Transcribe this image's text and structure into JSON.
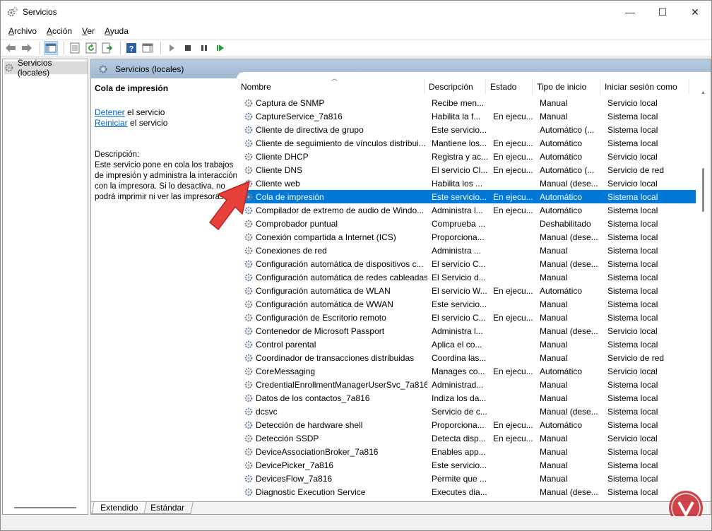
{
  "window": {
    "title": "Servicios",
    "minimize": "—",
    "maximize": "☐",
    "close": "✕"
  },
  "menu": [
    {
      "label": "Archivo",
      "ul": "A",
      "rest": "rchivo"
    },
    {
      "label": "Acción",
      "ul": "A",
      "rest": "cción"
    },
    {
      "label": "Ver",
      "ul": "V",
      "rest": "er"
    },
    {
      "label": "Ayuda",
      "ul": "A",
      "rest": "yuda"
    }
  ],
  "tree": {
    "root_label": "Servicios (locales)"
  },
  "pane": {
    "header_label": "Servicios (locales)",
    "selected_service": "Cola de impresión",
    "stop_link": "Detener",
    "stop_suffix": " el servicio",
    "restart_link": "Reiniciar",
    "restart_suffix": " el servicio",
    "desc_heading": "Descripción:",
    "desc_text": "Este servicio pone en cola los trabajos de impresión y administra la interacción con la impresora. Si lo desactiva, no podrá imprimir ni ver las impresoras."
  },
  "columns": [
    "Nombre",
    "Descripción",
    "Estado",
    "Tipo de inicio",
    "Iniciar sesión como"
  ],
  "rows": [
    [
      "Captura de SNMP",
      "Recibe men...",
      "",
      "Manual",
      "Servicio local"
    ],
    [
      "CaptureService_7a816",
      "Habilita la f...",
      "En ejecu...",
      "Manual",
      "Sistema local"
    ],
    [
      "Cliente de directiva de grupo",
      "Este servicio...",
      "",
      "Automático (...",
      "Sistema local"
    ],
    [
      "Cliente de seguimiento de vínculos distribui...",
      "Mantiene los...",
      "En ejecu...",
      "Automático",
      "Sistema local"
    ],
    [
      "Cliente DHCP",
      "Registra y ac...",
      "En ejecu...",
      "Automático",
      "Servicio local"
    ],
    [
      "Cliente DNS",
      "El servicio Cl...",
      "En ejecu...",
      "Automático (...",
      "Servicio de red"
    ],
    [
      "Cliente web",
      "Habilita los ...",
      "",
      "Manual (dese...",
      "Servicio local"
    ],
    [
      "Cola de impresión",
      "Este servicio...",
      "En ejecu...",
      "Automático",
      "Sistema local"
    ],
    [
      "Compilador de extremo de audio de Windo...",
      "Administra l...",
      "En ejecu...",
      "Automático",
      "Sistema local"
    ],
    [
      "Comprobador puntual",
      "Comprueba ...",
      "",
      "Deshabilitado",
      "Sistema local"
    ],
    [
      "Conexión compartida a Internet (ICS)",
      "Proporciona...",
      "",
      "Manual (dese...",
      "Sistema local"
    ],
    [
      "Conexiones de red",
      "Administra ...",
      "",
      "Manual",
      "Sistema local"
    ],
    [
      "Configuración automática de dispositivos c...",
      "El servicio C...",
      "",
      "Manual (dese...",
      "Sistema local"
    ],
    [
      "Configuración automática de redes cableadas",
      "El Servicio d...",
      "",
      "Manual",
      "Sistema local"
    ],
    [
      "Configuración automática de WLAN",
      "El servicio W...",
      "En ejecu...",
      "Automático",
      "Sistema local"
    ],
    [
      "Configuración automática de WWAN",
      "Este servicio...",
      "",
      "Manual",
      "Sistema local"
    ],
    [
      "Configuración de Escritorio remoto",
      "El servicio C...",
      "En ejecu...",
      "Manual",
      "Sistema local"
    ],
    [
      "Contenedor de Microsoft Passport",
      "Administra l...",
      "",
      "Manual (dese...",
      "Servicio local"
    ],
    [
      "Control parental",
      "Aplica el co...",
      "",
      "Manual",
      "Sistema local"
    ],
    [
      "Coordinador de transacciones distribuidas",
      "Coordina las...",
      "",
      "Manual",
      "Servicio de red"
    ],
    [
      "CoreMessaging",
      "Manages co...",
      "En ejecu...",
      "Automático",
      "Servicio local"
    ],
    [
      "CredentialEnrollmentManagerUserSvc_7a816",
      "Administrad...",
      "",
      "Manual",
      "Sistema local"
    ],
    [
      "Datos de los contactos_7a816",
      "Indiza los da...",
      "",
      "Manual",
      "Sistema local"
    ],
    [
      "dcsvc",
      "Servicio de c...",
      "",
      "Manual (dese...",
      "Sistema local"
    ],
    [
      "Detección de hardware shell",
      "Proporciona...",
      "En ejecu...",
      "Automático",
      "Sistema local"
    ],
    [
      "Detección SSDP",
      "Detecta disp...",
      "En ejecu...",
      "Manual",
      "Servicio local"
    ],
    [
      "DeviceAssociationBroker_7a816",
      "Enables app...",
      "",
      "Manual",
      "Sistema local"
    ],
    [
      "DevicePicker_7a816",
      "Este servicio...",
      "",
      "Manual",
      "Sistema local"
    ],
    [
      "DevicesFlow_7a816",
      "Permite que ...",
      "",
      "Manual",
      "Sistema local"
    ],
    [
      "Diagnostic Execution Service",
      "Executes dia...",
      "",
      "Manual (dese...",
      "Sistema local"
    ]
  ],
  "selected_row": 7,
  "tabs": [
    "Extendido",
    "Estándar"
  ],
  "colors": {
    "selection": "#0078d7",
    "header": "#a9c3da",
    "link": "#0066cc",
    "arrow": "#e8403a"
  }
}
